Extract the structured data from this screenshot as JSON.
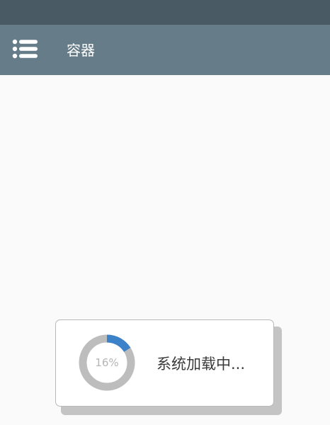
{
  "app_bar": {
    "menu_icon": "list-menu-icon",
    "title": "容器"
  },
  "loading_dialog": {
    "progress": 0.16,
    "progress_label": "16%",
    "message": "系统加载中...",
    "colors": {
      "progress": "#3b82c9",
      "track": "#bdbdbd"
    }
  },
  "colors": {
    "status_bar": "#4a5a65",
    "app_bar": "#667c89",
    "background": "#fafafa"
  }
}
